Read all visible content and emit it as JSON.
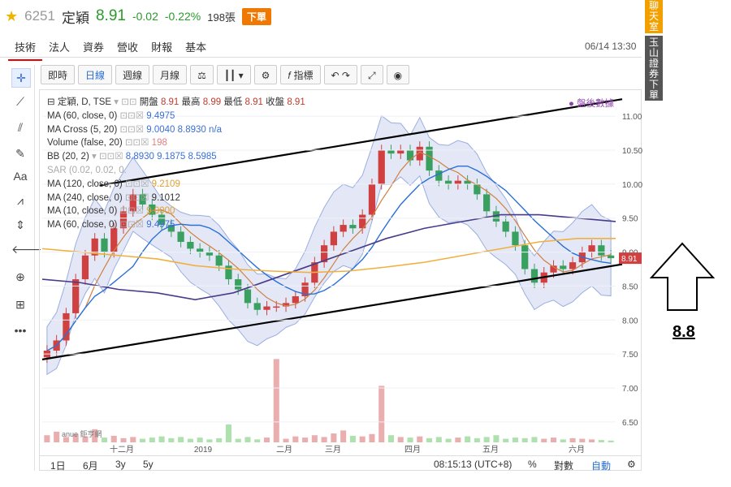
{
  "header": {
    "code": "6251",
    "name": "定穎",
    "price": "8.91",
    "change": "-0.02",
    "change_pct": "-0.22%",
    "volume": "198張",
    "order_button": "下單"
  },
  "tabs": [
    "技術",
    "法人",
    "資券",
    "營收",
    "財報",
    "基本"
  ],
  "datetime": "06/14 13:30",
  "toolbar": {
    "intraday": "即時",
    "daily": "日線",
    "weekly": "週線",
    "monthly": "月線",
    "indicators": "指標"
  },
  "legend": {
    "main": "定穎, D, TSE",
    "open_label": "開盤",
    "open": "8.91",
    "high_label": "最高",
    "high": "8.99",
    "low_label": "最低",
    "low": "8.91",
    "close_label": "收盤",
    "close": "8.91",
    "ma60": "MA (60, close, 0)",
    "ma60_v": "9.4975",
    "macross": "MA Cross (5, 20)",
    "macross_v1": "9.0040",
    "macross_v2": "8.8930",
    "macross_v3": "n/a",
    "volume": "Volume (false, 20)",
    "volume_v": "198",
    "bb": "BB (20, 2)",
    "bb_v1": "8.8930",
    "bb_v2": "9.1875",
    "bb_v3": "8.5985",
    "sar": "SAR (0.02, 0.02, 0.",
    "ma120": "MA (120, close, 0)",
    "ma120_v": "9.2109",
    "ma240": "MA (240, close, 0)",
    "ma240_v": "9.1012",
    "ma10": "MA (10, close, 0)",
    "ma10_v": "9.0000",
    "ma60b": "MA (60, close, 0)",
    "ma60b_v": "9.4975"
  },
  "after_hours": "盤後數據",
  "bottom": {
    "r1d": "1日",
    "r6m": "6月",
    "r3y": "3y",
    "r5y": "5y",
    "time": "08:15:13 (UTC+8)",
    "pct": "%",
    "log": "對數",
    "auto": "自動"
  },
  "side_chat": "聊天室",
  "side_broker": "玉山證券下單",
  "annotation_value": "8.8",
  "watermark": "anue 鉅亨網",
  "chart_data": {
    "type": "candlestick",
    "price_axis_ticks": [
      6.5,
      7.0,
      7.5,
      8.0,
      8.5,
      9.0,
      9.5,
      10.0,
      10.5,
      11.0
    ],
    "price_axis_range": [
      6.2,
      11.3
    ],
    "x_tick_labels": [
      "十二月",
      "2019",
      "二月",
      "三月",
      "四月",
      "五月",
      "六月"
    ],
    "last_price_tag": "8.91",
    "closes": [
      7.55,
      7.7,
      8.1,
      8.6,
      8.95,
      9.2,
      9.0,
      9.35,
      9.6,
      9.85,
      9.7,
      9.55,
      9.4,
      9.3,
      9.15,
      9.05,
      9.0,
      8.95,
      8.8,
      8.6,
      8.45,
      8.25,
      8.15,
      8.2,
      8.2,
      8.25,
      8.35,
      8.55,
      8.85,
      9.1,
      9.3,
      9.4,
      9.35,
      9.55,
      10.0,
      10.5,
      10.45,
      10.5,
      10.35,
      10.55,
      10.2,
      10.05,
      10.0,
      10.05,
      10.0,
      9.85,
      9.6,
      9.45,
      9.3,
      9.1,
      8.75,
      8.55,
      8.7,
      8.8,
      8.75,
      8.85,
      9.0,
      9.1,
      8.95,
      8.91
    ],
    "volumes": [
      12,
      18,
      9,
      14,
      10,
      22,
      8,
      11,
      7,
      9,
      6,
      8,
      10,
      7,
      9,
      6,
      8,
      5,
      7,
      30,
      6,
      9,
      5,
      8,
      140,
      6,
      10,
      8,
      12,
      9,
      15,
      20,
      11,
      10,
      14,
      95,
      12,
      9,
      8,
      10,
      7,
      9,
      6,
      8,
      10,
      7,
      9,
      12,
      6,
      8,
      7,
      9,
      6,
      8,
      5,
      7,
      6,
      5,
      4,
      3
    ],
    "trendline_upper": [
      [
        0.1,
        9.98
      ],
      [
        1.0,
        11.25
      ]
    ],
    "trendline_lower": [
      [
        0.0,
        7.42
      ],
      [
        1.0,
        8.82
      ]
    ],
    "ma60_line": [
      8.6,
      8.55,
      8.45,
      8.4,
      8.3,
      8.4,
      8.6,
      8.8,
      9.0,
      9.2,
      9.35,
      9.45,
      9.55,
      9.55,
      9.5,
      9.45
    ],
    "ma240_line": [
      9.05,
      9.0,
      8.95,
      8.9,
      8.8,
      8.75,
      8.72,
      8.7,
      8.72,
      8.78,
      8.85,
      8.95,
      9.05,
      9.15,
      9.2,
      9.2
    ]
  }
}
